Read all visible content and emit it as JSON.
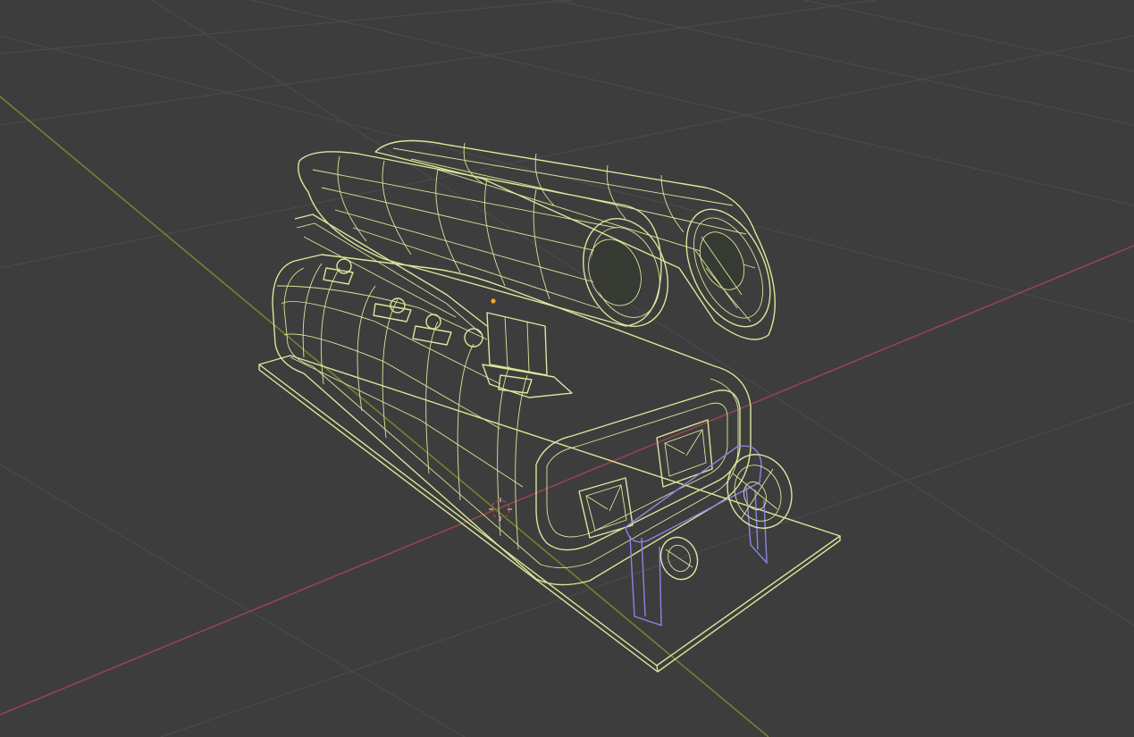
{
  "viewport": {
    "mode": "wireframe",
    "object": "engine-blower-model",
    "colors": {
      "background": "#3d3d3d",
      "grid": "#4a4a4a",
      "axis_x": "#9a4450",
      "axis_y": "#6f8a2e",
      "wire_selected": "#d8e89a",
      "wire_secondary": "#8a86e6",
      "origin_point": "#f5a623",
      "cursor_3d": "#e0e0e0"
    }
  }
}
